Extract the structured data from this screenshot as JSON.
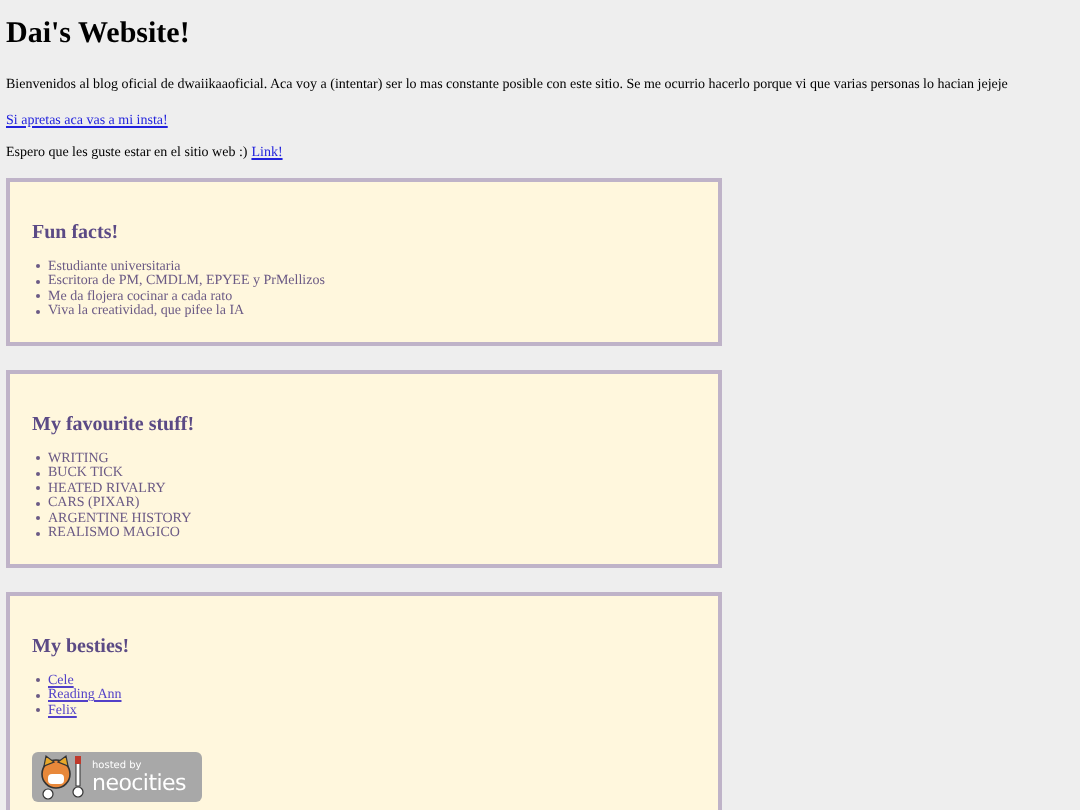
{
  "title": "Dai's Website!",
  "intro": "Bienvenidos al blog oficial de dwaiikaaoficial. Aca voy a (intentar) ser lo mas constante posible con este sitio. Se me ocurrio hacerlo porque vi que varias personas lo hacian jejeje",
  "insta_link": "Si apretas aca vas a mi insta!",
  "closing": {
    "text": "Espero que les guste estar en el sitio web :)",
    "link": "Link!"
  },
  "sections": [
    {
      "heading": "Fun facts!",
      "kind": "text",
      "items": [
        "Estudiante universitaria",
        "Escritora de PM, CMDLM, EPYEE y PrMellizos",
        "Me da flojera cocinar a cada rato",
        "Viva la creatividad, que pifee la IA"
      ]
    },
    {
      "heading": "My favourite stuff!",
      "kind": "text",
      "items": [
        "WRITING",
        "BUCK TICK",
        "HEATED RIVALRY",
        "CARS (PIXAR)",
        "ARGENTINE HISTORY",
        "REALISMO MAGICO"
      ]
    },
    {
      "heading": "My besties!",
      "kind": "links",
      "items": [
        "Cele",
        "Reading Ann",
        "Felix"
      ],
      "badge": {
        "line_1": "hosted by",
        "line_2": "neocities"
      }
    }
  ]
}
